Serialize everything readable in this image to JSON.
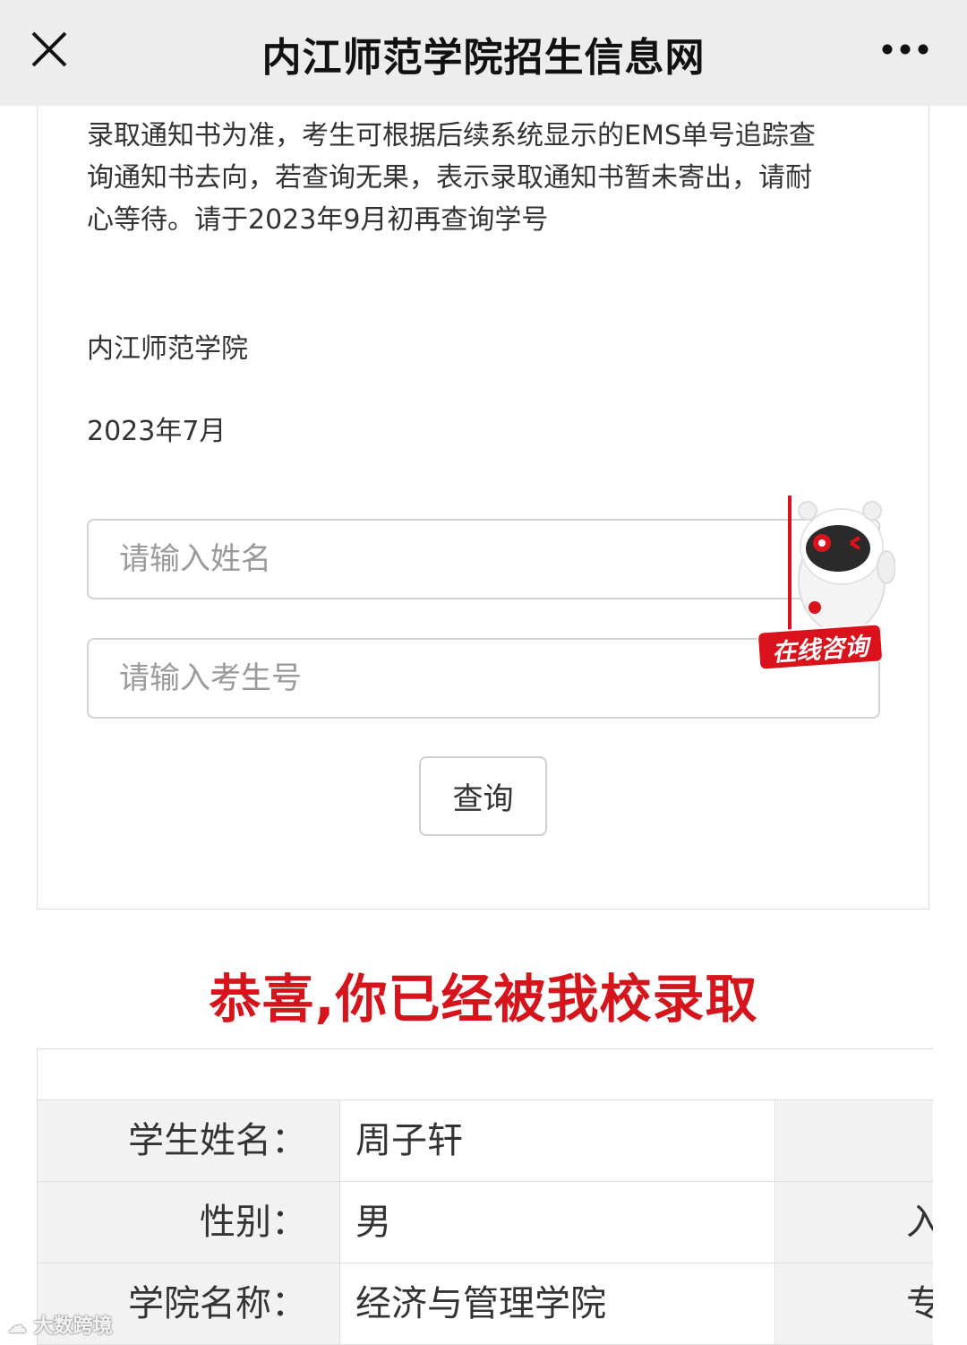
{
  "header": {
    "title": "内江师范学院招生信息网"
  },
  "notice": {
    "line1": "录取通知书为准，考生可根据后续系统显示的EMS单号追踪查",
    "line2": "询通知书去向，若查询无果，表示录取通知书暂未寄出，请耐",
    "line3": "心等待。请于2023年9月初再查询学号",
    "signature": "内江师范学院",
    "date": "2023年7月"
  },
  "form": {
    "name_placeholder": "请输入姓名",
    "exam_no_placeholder": "请输入考生号",
    "query_button": "查询"
  },
  "consult": {
    "label": "在线咨询"
  },
  "result": {
    "headline": "恭喜,你已经被我校录取",
    "rows": [
      {
        "label": "学生姓名：",
        "value": "周子轩",
        "label2": ""
      },
      {
        "label": "性别：",
        "value": "男",
        "label2": "入"
      },
      {
        "label": "学院名称：",
        "value": "经济与管理学院",
        "label2": "专"
      }
    ]
  },
  "watermark": "大数跨境",
  "colors": {
    "accent_red": "#d5141c",
    "topbar_bg": "#ededed",
    "label_bg": "#f2f2f2"
  }
}
